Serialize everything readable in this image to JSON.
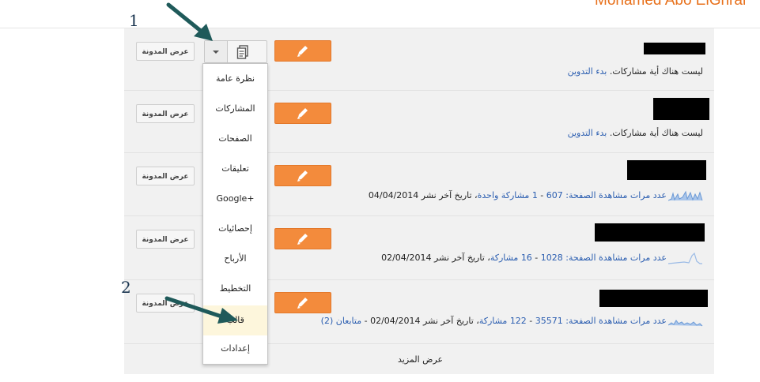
{
  "header": {
    "user_name": "Mohamed Abo ElGhrar"
  },
  "annotations": {
    "step1": "1",
    "step2": "2"
  },
  "colors": {
    "accent": "#f38b3c",
    "link": "#2a5db0",
    "arrow": "#1f5a5a"
  },
  "blogs": [
    {
      "view_label": "عرض المدونة",
      "empty_text": "ليست هناك أية مشاركات.",
      "start_link": "بدء التدوين"
    },
    {
      "view_label": "عرض المدونة",
      "empty_text": "ليست هناك أية مشاركات.",
      "start_link": "بدء التدوين"
    },
    {
      "view_label": "عرض المدونة",
      "pageviews_label": "عدد مرات مشاهدة الصفحة:",
      "pageviews": "607",
      "posts": "1 مشاركة واحدة",
      "last_published_label": "تاريخ آخر نشر",
      "last_published": "04/04/2014"
    },
    {
      "view_label": "عرض المدونة",
      "pageviews_label": "عدد مرات مشاهدة الصفحة:",
      "pageviews": "1028",
      "posts": "16 مشاركة",
      "last_published_label": "تاريخ آخر نشر",
      "last_published": "02/04/2014"
    },
    {
      "view_label": "عرض المدونة",
      "pageviews_label": "عدد مرات مشاهدة الصفحة:",
      "pageviews": "35571",
      "posts": "122 مشاركة",
      "last_published_label": "تاريخ آخر نشر",
      "last_published": "02/04/2014",
      "followers": "متابعان (2)"
    }
  ],
  "menu": {
    "items": [
      "نظرة عامة",
      "المشاركات",
      "الصفحات",
      "تعليقات",
      "Google+",
      "إحصائيات",
      "الأرباح",
      "التخطيط",
      "قالب",
      "إعدادات"
    ]
  },
  "show_more": "عرض المزيد"
}
